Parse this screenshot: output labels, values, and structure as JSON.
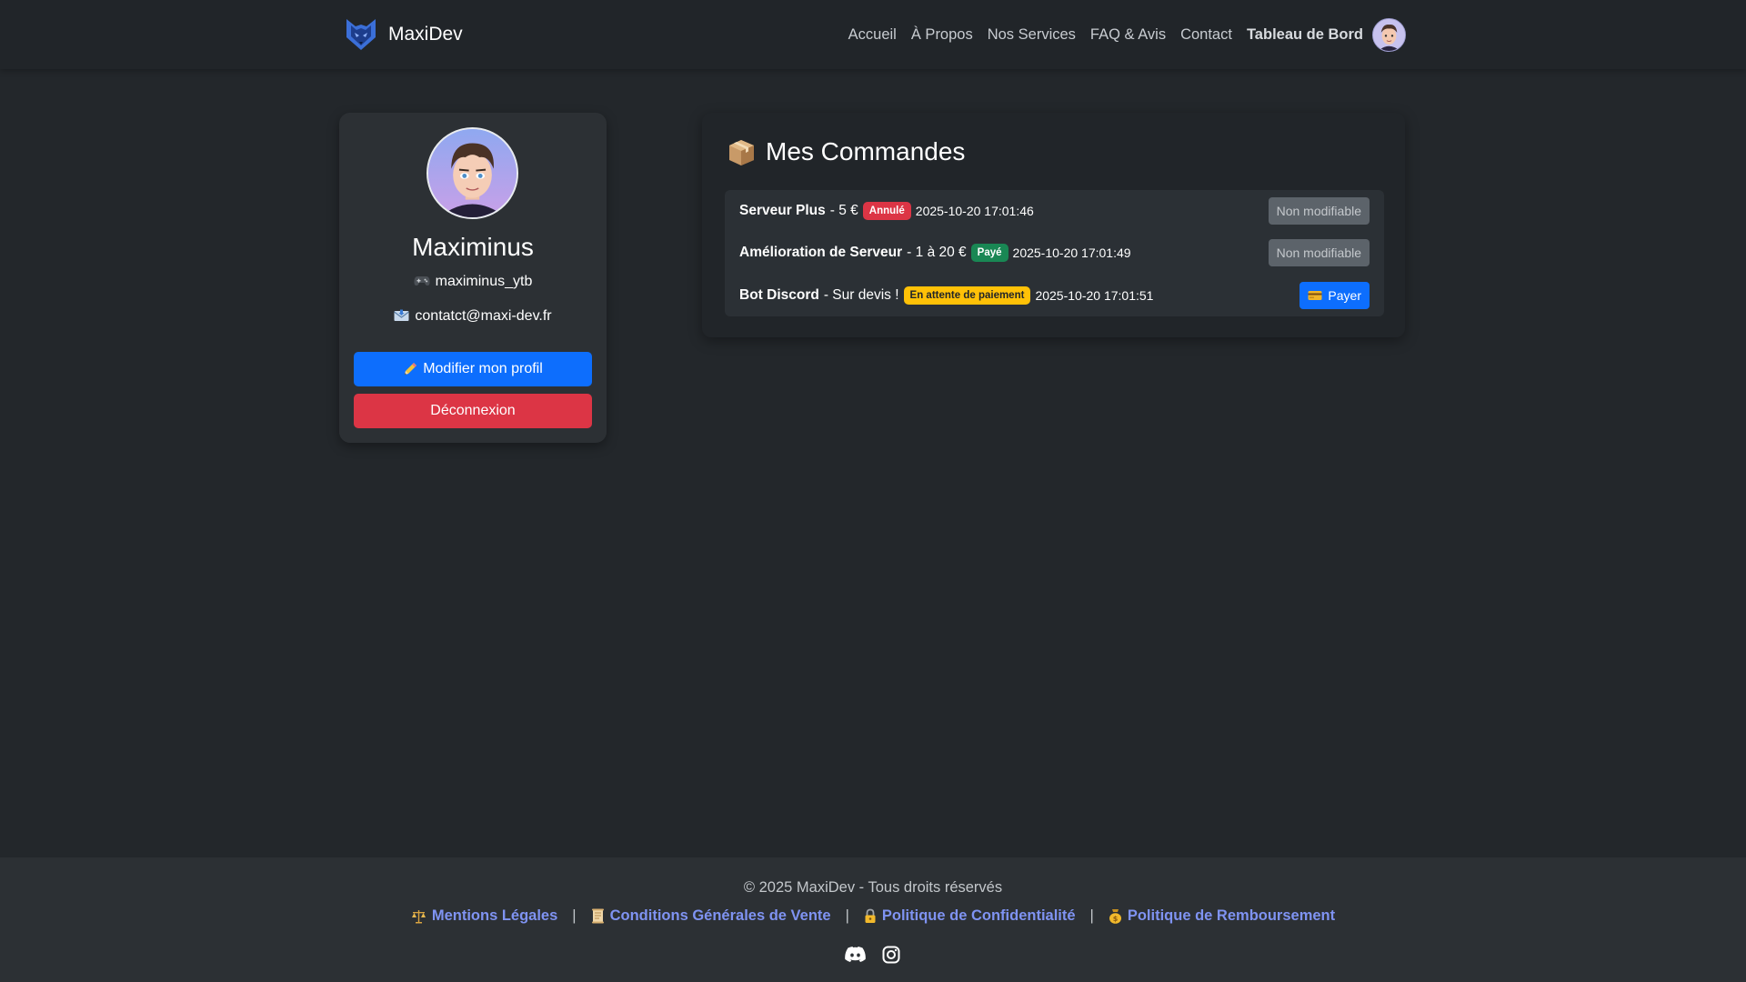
{
  "nav": {
    "brand": "MaxiDev",
    "links": [
      "Accueil",
      "À Propos",
      "Nos Services",
      "FAQ & Avis",
      "Contact"
    ],
    "dashboard": "Tableau de Bord"
  },
  "profile": {
    "name": "Maximinus",
    "discord": "maximinus_ytb",
    "email": "contatct@maxi-dev.fr",
    "edit_label": "Modifier mon profil",
    "logout_label": "Déconnexion"
  },
  "orders": {
    "title": "Mes Commandes",
    "items": [
      {
        "name": "Serveur Plus",
        "price": "- 5 €",
        "status": "Annulé",
        "status_color": "#dc3545",
        "date": "2025-10-20 17:01:46",
        "action": "Non modifiable"
      },
      {
        "name": "Amélioration de Serveur",
        "price": "- 1 à 20 €",
        "status": "Payé",
        "status_color": "#198754",
        "date": "2025-10-20 17:01:49",
        "action": "Non modifiable"
      },
      {
        "name": "Bot Discord",
        "price": "- Sur devis !",
        "status": "En attente de paiement",
        "status_color": "#ffc107",
        "date": "2025-10-20 17:01:51",
        "action": "Payer"
      }
    ]
  },
  "footer": {
    "copyright": "© 2025 MaxiDev - Tous droits réservés",
    "links": [
      "Mentions Légales",
      "Conditions Générales de Vente",
      "Politique de Confidentialité",
      "Politique de Remboursement"
    ],
    "separator": "|",
    "social": [
      "discord-icon",
      "instagram-icon"
    ]
  },
  "colors": {
    "background": "#23272b",
    "primary": "#0d6efd",
    "danger": "#dc3545",
    "success": "#198754",
    "warning": "#ffc107",
    "link": "#7f93f2"
  }
}
